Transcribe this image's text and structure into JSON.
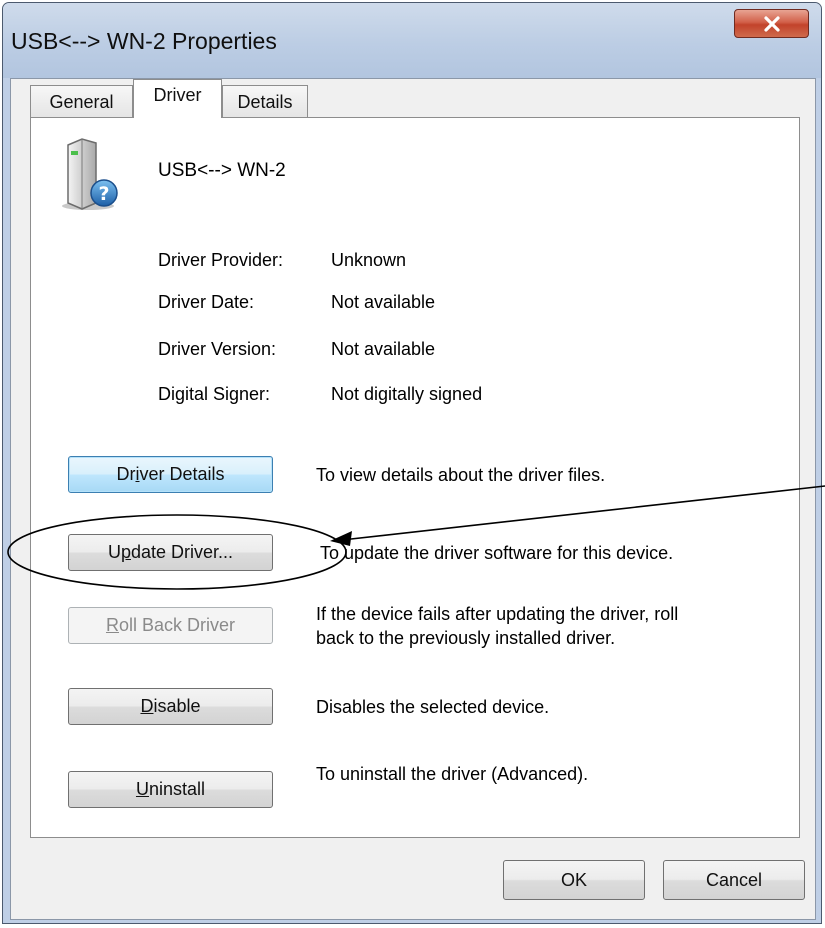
{
  "window": {
    "title": "USB<--> WN-2 Properties",
    "close_glyph": "X"
  },
  "tabs": [
    {
      "label": "General",
      "active": false
    },
    {
      "label": "Driver",
      "active": true
    },
    {
      "label": "Details",
      "active": false
    }
  ],
  "device": {
    "name": "USB<--> WN-2",
    "icon": "unknown-device-icon"
  },
  "driver_info": [
    {
      "label": "Driver Provider:",
      "value": "Unknown"
    },
    {
      "label": "Driver Date:",
      "value": "Not available"
    },
    {
      "label": "Driver Version:",
      "value": "Not available"
    },
    {
      "label": "Digital Signer:",
      "value": "Not digitally signed"
    }
  ],
  "actions": [
    {
      "pre": "Dr",
      "mnemonic": "i",
      "post": "ver Details",
      "description": [
        "To view details about the driver files."
      ],
      "enabled": true,
      "focused": true
    },
    {
      "pre": "U",
      "mnemonic": "p",
      "post": "date Driver...",
      "description": [
        "To update the driver software for this device."
      ],
      "enabled": true,
      "focused": false
    },
    {
      "pre": "",
      "mnemonic": "R",
      "post": "oll Back Driver",
      "description": [
        "If the device fails after updating the driver, roll",
        "back to the previously installed driver."
      ],
      "enabled": false,
      "focused": false
    },
    {
      "pre": "",
      "mnemonic": "D",
      "post": "isable",
      "description": [
        "Disables the selected device."
      ],
      "enabled": true,
      "focused": false
    },
    {
      "pre": "",
      "mnemonic": "U",
      "post": "ninstall",
      "description": [
        "To uninstall the driver (Advanced)."
      ],
      "enabled": true,
      "focused": false
    }
  ],
  "footer": {
    "ok_label": "OK",
    "cancel_label": "Cancel"
  },
  "colors": {
    "title_bar": "#bfcfe6",
    "close_button": "#c9503a",
    "focus_button": "#bee6fd"
  }
}
